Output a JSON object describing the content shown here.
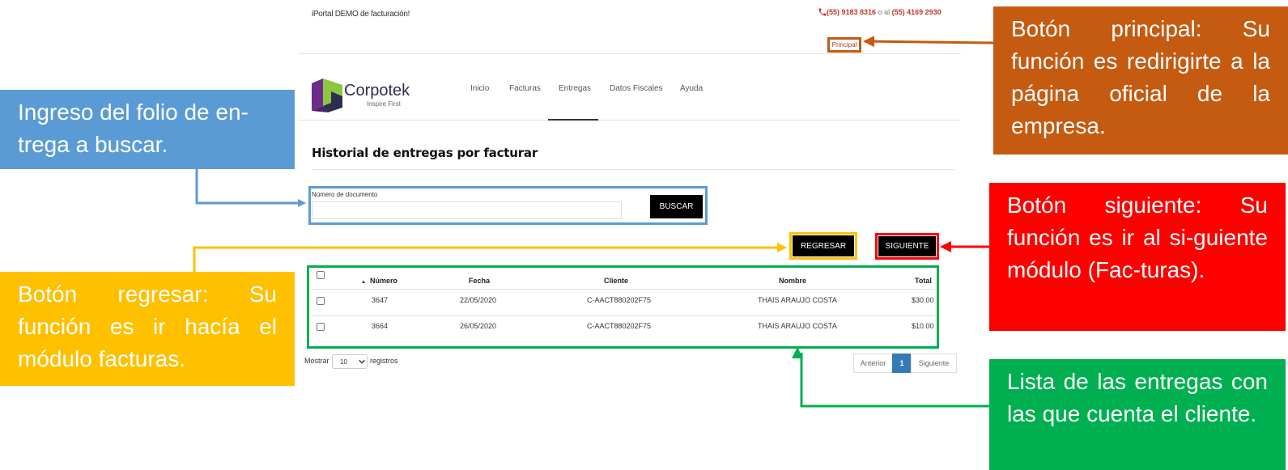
{
  "header": {
    "portal_text": "iPortal DEMO de facturación!",
    "phone_1": "(55) 9183 8316",
    "phone_sep": " o al ",
    "phone_2": "(55) 4169 2930",
    "principal_label": "Principal"
  },
  "brand": {
    "name": "Corpotek",
    "tagline": "Inspire First"
  },
  "nav": {
    "items": [
      {
        "label": "Inicio"
      },
      {
        "label": "Facturas"
      },
      {
        "label": "Entregas"
      },
      {
        "label": "Datos Fiscales"
      },
      {
        "label": "Ayuda"
      }
    ],
    "active": "Entregas"
  },
  "page": {
    "title": "Historial de entregas por facturar"
  },
  "search": {
    "label": "Número de documento",
    "value": "",
    "button_label": "BUSCAR"
  },
  "actions": {
    "regresar_label": "REGRESAR",
    "siguiente_label": "SIGUIENTE"
  },
  "table": {
    "sort_indicator": "▲",
    "headers": [
      "Número",
      "Fecha",
      "Cliente",
      "Nombre",
      "Total"
    ],
    "rows": [
      {
        "numero": "3647",
        "fecha": "22/05/2020",
        "cliente": "C-AACT880202F75",
        "nombre": "THAIS ARAUJO COSTA",
        "total": "$30.00"
      },
      {
        "numero": "3664",
        "fecha": "26/05/2020",
        "cliente": "C-AACT880202F75",
        "nombre": "THAIS ARAUJO COSTA",
        "total": "$10.00"
      }
    ]
  },
  "length_menu": {
    "prefix": "Mostrar",
    "value": "10",
    "suffix": "registros"
  },
  "pagination": {
    "prev": "Anterior",
    "current": "1",
    "next": "Siguiente"
  },
  "annotations": {
    "search": "Ingreso del folio de en-trega a buscar.",
    "regresar": "Botón regresar: Su función es ir hacía el módulo facturas.",
    "principal": "Botón principal: Su función es redirigirte a la página oficial de la empresa.",
    "siguiente": "Botón siguiente: Su función es ir al si-guiente módulo (Fac-turas).",
    "table": "Lista de las entregas con las que cuenta el cliente."
  },
  "colors": {
    "blue": "#5b9bd5",
    "yellow": "#ffc000",
    "orange": "#c55a11",
    "red": "#ff0000",
    "green": "#00b050",
    "phone": "#c0392b",
    "pagination_active": "#337ab7"
  }
}
